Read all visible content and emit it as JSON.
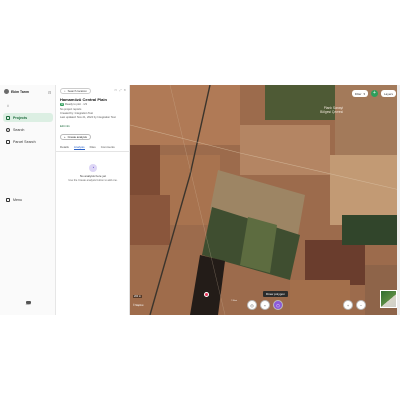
{
  "nav": {
    "brand": "Ekim Tarım",
    "hash": "#",
    "items": [
      {
        "label": "Projects"
      },
      {
        "label": "Search"
      },
      {
        "label": "Parcel Search"
      },
      {
        "label": "Menu"
      }
    ],
    "logo_text": "ekim"
  },
  "panel": {
    "search_button": "Search location",
    "title": "Hamamözü Central Plain",
    "meta": [
      "Ready to plot · 1/3",
      "No project reports",
      "Created by: Integration Test",
      "Last updated: Nov 21, 2024 by Integration Test"
    ],
    "badge": "AI",
    "edit_link": "Edit info",
    "create_button": "Create analysis",
    "tabs": [
      "Details",
      "Analysis",
      "Files",
      "Comments"
    ],
    "active_tab": "Analysis",
    "empty_title": "No analysis here yet",
    "empty_sub": "Use the Create analysis button to add one."
  },
  "map": {
    "place_label": "Planlı Sanayi\nBölgesi Çevresi",
    "filter_button": "Filter",
    "layers_button": "Layers",
    "plus_label": "+",
    "tooltip": "Draw polygon",
    "scale": "200 m",
    "credit": "© Mapbox",
    "attribution": "© Esri"
  }
}
